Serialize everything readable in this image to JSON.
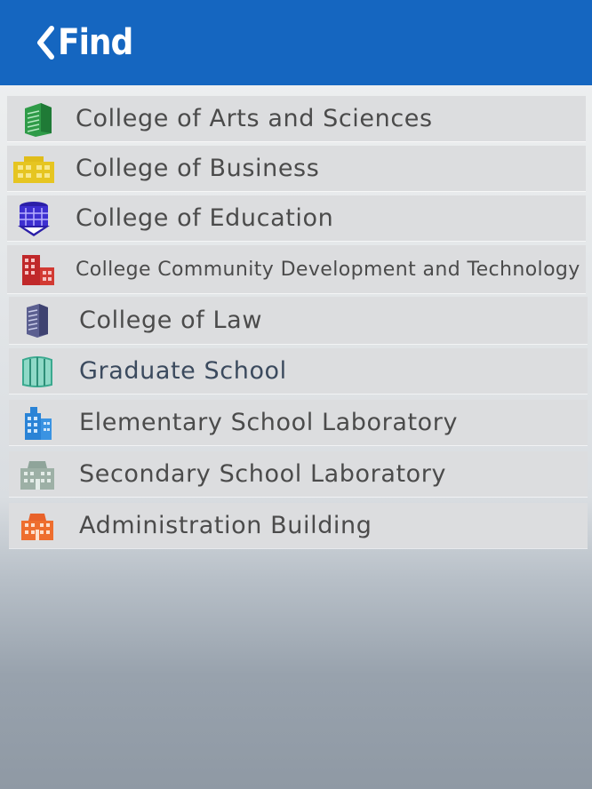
{
  "header": {
    "back_label": "Find",
    "background": "#1566c0"
  },
  "items": [
    {
      "label": "College of Arts and Sciences",
      "icon": "green-building-icon",
      "color": "#2e9e4a"
    },
    {
      "label": "College of Business",
      "icon": "yellow-building-icon",
      "color": "#e2c21c"
    },
    {
      "label": "College of Education",
      "icon": "purple-building-icon",
      "color": "#3f2fd1"
    },
    {
      "label": "College Community Development and Technology",
      "icon": "red-building-icon",
      "color": "#c22a2a"
    },
    {
      "label": "College of Law",
      "icon": "slate-building-icon",
      "color": "#5a5f8e"
    },
    {
      "label": "Graduate School",
      "icon": "teal-building-icon",
      "color": "#3fb39a"
    },
    {
      "label": "Elementary School Laboratory",
      "icon": "blue-building-icon",
      "color": "#2b84d6"
    },
    {
      "label": "Secondary School Laboratory",
      "icon": "gray-building-icon",
      "color": "#8fa39a"
    },
    {
      "label": "Administration Building",
      "icon": "orange-building-icon",
      "color": "#e8662a"
    }
  ]
}
